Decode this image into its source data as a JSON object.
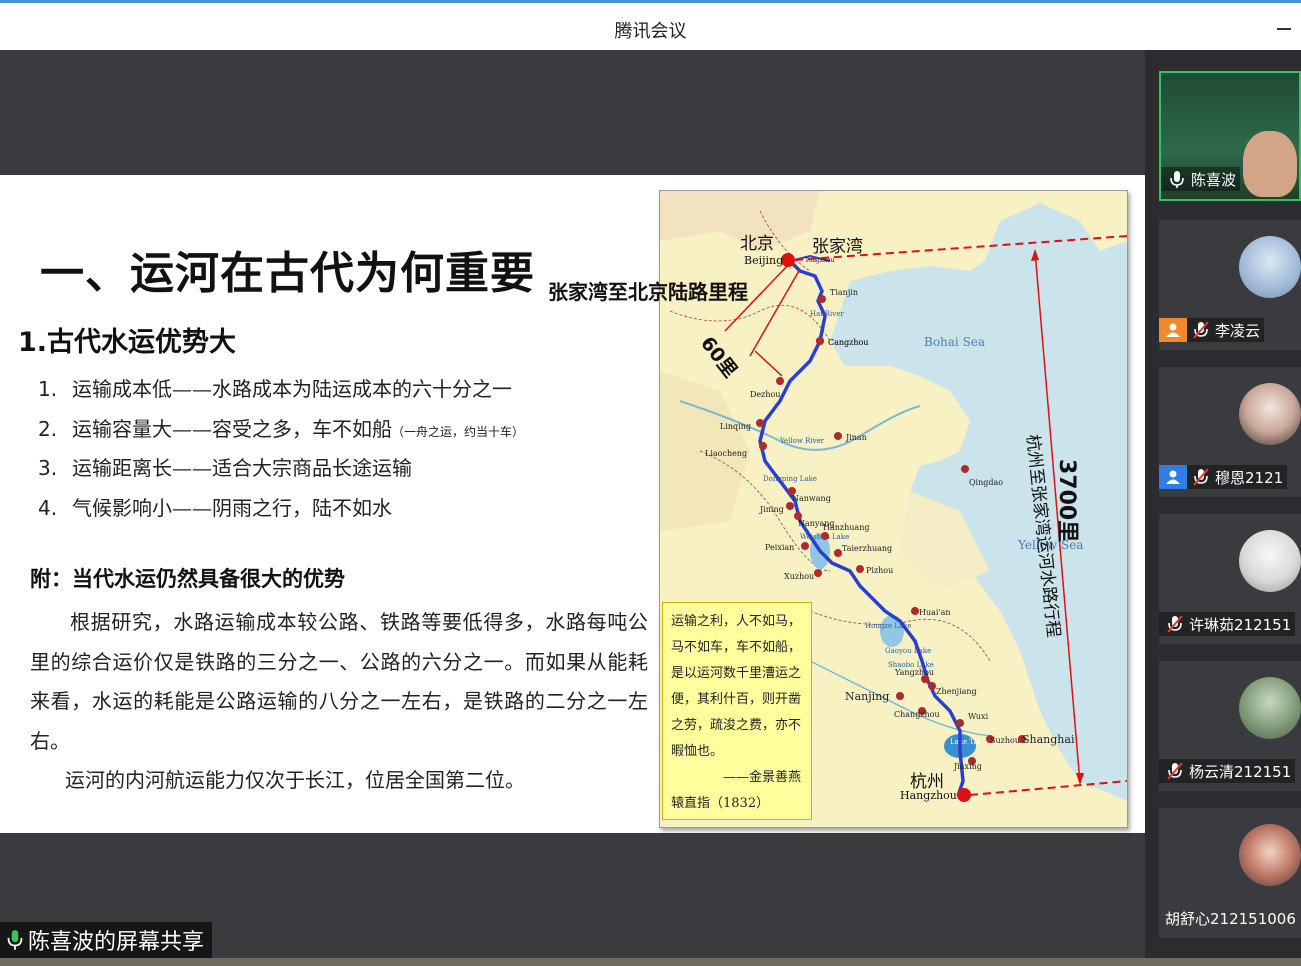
{
  "window": {
    "title": "腾讯会议"
  },
  "slide": {
    "heading": "一、运河在古代为何重要",
    "subheading": "1.古代水运优势大",
    "list": [
      {
        "num": "1.",
        "text": "运输成本低——水路成本为陆运成本的六十分之一",
        "note": ""
      },
      {
        "num": "2.",
        "text": "运输容量大——容受之多，车不如船",
        "note": "（一舟之运，约当十车）"
      },
      {
        "num": "3.",
        "text": "运输距离长——适合大宗商品长途运输",
        "note": ""
      },
      {
        "num": "4.",
        "text": "气候影响小——阴雨之行，陆不如水",
        "note": ""
      }
    ],
    "appendix_title": "附：当代水运仍然具备很大的优势",
    "paragraph1": "根据研究，水路运输成本较公路、铁路等要低得多，水路每吨公里的综合运价仅是铁路的三分之一、公路的六分之一。而如果从能耗来看，水运的耗能是公路运输的八分之一左右，是铁路的二分之一左右。",
    "paragraph2": "运河的内河航运能力仅次于长江，位居全国第二位。",
    "map": {
      "label_beijing_cn": "北京",
      "label_beijing_en": "Beijing",
      "label_zhangjiawan": "张家湾",
      "label_tongzhou": "Tongzhou",
      "land_route_title": "张家湾至北京陆路里程",
      "land_distance": "60里",
      "water_distance": "3700里",
      "water_route_title": "杭州至张家湾运河水路行程",
      "label_hangzhou_cn": "杭州",
      "label_hangzhou_en": "Hangzhou",
      "sea_bohai": "Bohai Sea",
      "sea_yellow": "Yellow Sea",
      "cities": [
        {
          "name": "Tianjin"
        },
        {
          "name": "Cangzhou"
        },
        {
          "name": "Cangzhou"
        },
        {
          "name": "Dezhou"
        },
        {
          "name": "Linqing"
        },
        {
          "name": "Liaocheng"
        },
        {
          "name": "Jinan"
        },
        {
          "name": "Qingdao"
        },
        {
          "name": "Nanwang"
        },
        {
          "name": "Jining"
        },
        {
          "name": "Nanyang"
        },
        {
          "name": "Hanzhuang"
        },
        {
          "name": "Taierzhuang"
        },
        {
          "name": "Peixian"
        },
        {
          "name": "Pizhou"
        },
        {
          "name": "Xuzhou"
        },
        {
          "name": "Huai'an"
        },
        {
          "name": "Yangzhou"
        },
        {
          "name": "Zhenjiang"
        },
        {
          "name": "Nanjing"
        },
        {
          "name": "Changzhou"
        },
        {
          "name": "Wuxi"
        },
        {
          "name": "Suzhou"
        },
        {
          "name": "Shanghai"
        },
        {
          "name": "Jiaxing"
        }
      ],
      "lakes": [
        "Hai River",
        "Dongping Lake",
        "Weishan Lake",
        "Hongze Lake",
        "Gaoyou Lake",
        "Shaobo Lake",
        "Lake Tai",
        "Yellow River"
      ]
    },
    "quote": {
      "text": "运输之利，人不如马，马不如车，车不如船，是以运河数千里漕运之便，其利什百，则开凿之劳，疏浚之费，亦不暇恤也。",
      "author": "——金景善燕",
      "source": "辕直指（1832）"
    }
  },
  "participants": [
    {
      "name": "陈喜波",
      "mic": "on",
      "active": true,
      "user_icon": "none"
    },
    {
      "name": "李凌云",
      "mic": "muted",
      "active": false,
      "user_icon": "orange"
    },
    {
      "name": "穆恩2121",
      "mic": "muted",
      "active": false,
      "user_icon": "blue"
    },
    {
      "name": "许琳茹212151",
      "mic": "muted",
      "active": false,
      "user_icon": "none"
    },
    {
      "name": "杨云清212151",
      "mic": "muted",
      "active": false,
      "user_icon": "none"
    },
    {
      "name": "胡舒心212151006",
      "mic": "none",
      "active": false,
      "user_icon": "none"
    }
  ],
  "share_banner": "陈喜波的屏幕共享",
  "colors": {
    "accent_green": "#35c35c",
    "route_blue": "#2a3fd0",
    "marker_red": "#e01010",
    "quote_bg": "#ffff9e"
  }
}
